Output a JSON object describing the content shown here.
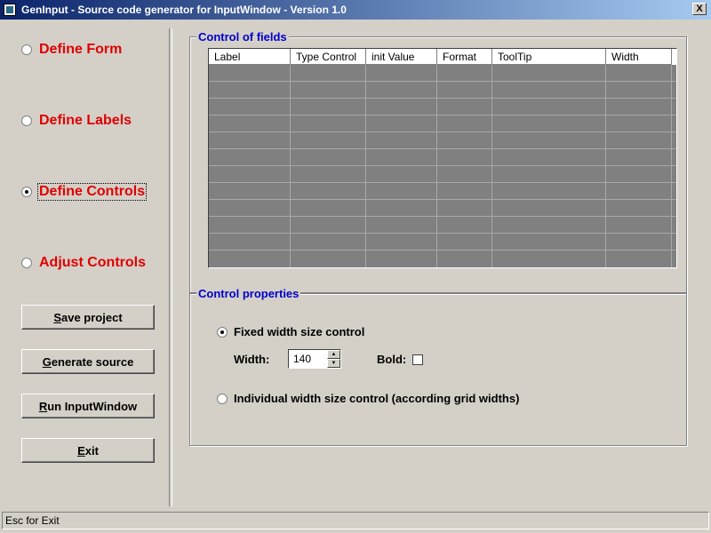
{
  "window": {
    "title": "GenInput - Source code generator for InputWindow - Version 1.0",
    "close_label": "X"
  },
  "nav": {
    "items": [
      {
        "label": "Define Form",
        "checked": false
      },
      {
        "label": "Define Labels",
        "checked": false
      },
      {
        "label": "Define Controls",
        "checked": true
      },
      {
        "label": "Adjust Controls",
        "checked": false
      }
    ]
  },
  "buttons": {
    "save": {
      "mnemonic": "S",
      "rest": "ave project"
    },
    "generate": {
      "mnemonic": "G",
      "rest": "enerate source"
    },
    "run": {
      "mnemonic": "R",
      "rest": "un InputWindow"
    },
    "exit": {
      "mnemonic": "E",
      "rest": "xit"
    }
  },
  "fields_group": {
    "title": "Control of fields",
    "columns": [
      "Label",
      "Type Control",
      "init Value",
      "Format",
      "ToolTip",
      "Width"
    ]
  },
  "properties": {
    "title": "Control properties",
    "fixed_label": "Fixed width size control",
    "fixed_checked": true,
    "width_label": "Width:",
    "width_value": "140",
    "bold_label": "Bold:",
    "individual_label": "Individual width size control (according grid widths)",
    "individual_checked": false
  },
  "status": {
    "text": "Esc for Exit"
  },
  "colors": {
    "nav_label": "#e00000",
    "group_title": "#0000cc",
    "grid_background": "#808080"
  }
}
